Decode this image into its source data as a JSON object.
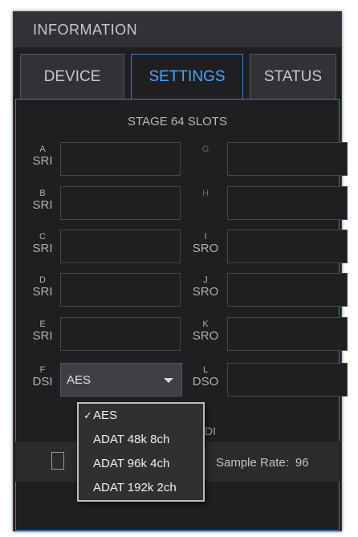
{
  "panel": {
    "title": "INFORMATION"
  },
  "tabs": [
    {
      "label": "DEVICE",
      "active": false
    },
    {
      "label": "SETTINGS",
      "active": true
    },
    {
      "label": "STATUS",
      "active": false
    }
  ],
  "slots_title": "STAGE 64 SLOTS",
  "slots": [
    {
      "letter": "A",
      "type": "SRI",
      "value": ""
    },
    {
      "letter": "G",
      "type": "",
      "value": ""
    },
    {
      "letter": "B",
      "type": "SRI",
      "value": ""
    },
    {
      "letter": "H",
      "type": "",
      "value": ""
    },
    {
      "letter": "C",
      "type": "SRI",
      "value": ""
    },
    {
      "letter": "I",
      "type": "SRO",
      "value": ""
    },
    {
      "letter": "D",
      "type": "SRI",
      "value": ""
    },
    {
      "letter": "J",
      "type": "SRO",
      "value": ""
    },
    {
      "letter": "E",
      "type": "SRI",
      "value": ""
    },
    {
      "letter": "K",
      "type": "SRO",
      "value": ""
    },
    {
      "letter": "F",
      "type": "DSI",
      "value": "AES"
    },
    {
      "letter": "L",
      "type": "DSO",
      "value": ""
    }
  ],
  "lower": {
    "partial_label": "DI",
    "sample_rate_label": "Sample Rate:",
    "sample_rate_value": "96"
  },
  "dropdown_menu": {
    "check_glyph": "✓",
    "items": [
      {
        "label": "AES",
        "selected": true
      },
      {
        "label": "ADAT 48k 8ch",
        "selected": false
      },
      {
        "label": "ADAT 96k 4ch",
        "selected": false
      },
      {
        "label": "ADAT 192k 2ch",
        "selected": false
      }
    ]
  },
  "colors": {
    "accent": "#2f7fd6",
    "active_tab_text": "#4da3ff",
    "panel_bg": "#1f1f21"
  }
}
